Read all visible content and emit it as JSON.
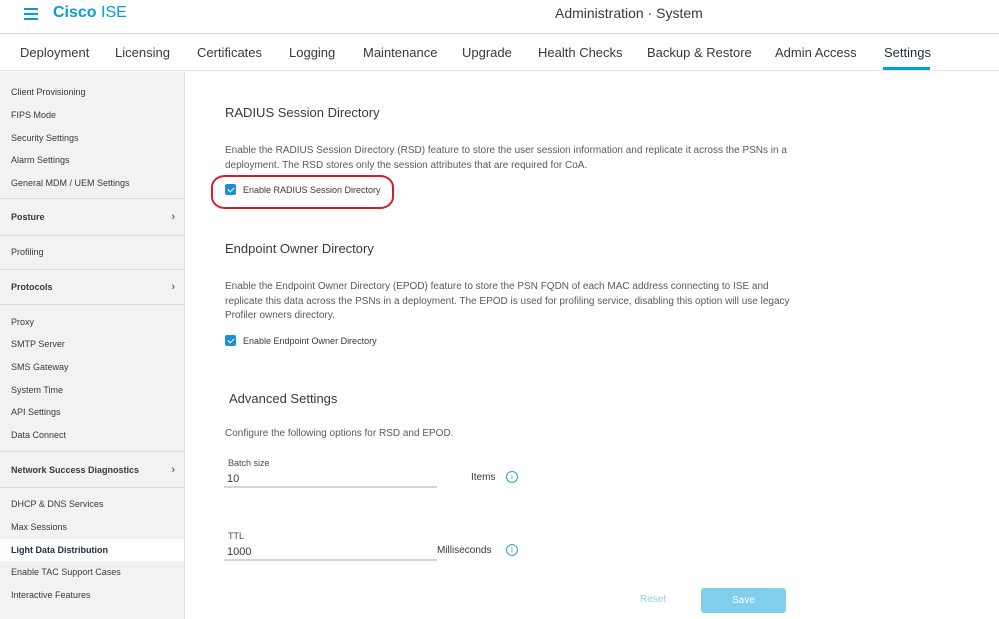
{
  "header": {
    "brand_bold": "Cisco",
    "brand_light": "ISE",
    "title": "Administration · System",
    "accent_color": "#049fd9"
  },
  "tabs": [
    {
      "label": "Deployment"
    },
    {
      "label": "Licensing"
    },
    {
      "label": "Certificates"
    },
    {
      "label": "Logging"
    },
    {
      "label": "Maintenance"
    },
    {
      "label": "Upgrade"
    },
    {
      "label": "Health Checks"
    },
    {
      "label": "Backup & Restore"
    },
    {
      "label": "Admin Access"
    },
    {
      "label": "Settings",
      "active": true
    }
  ],
  "sidebar": {
    "items": [
      {
        "label": "Client Provisioning"
      },
      {
        "label": "FIPS Mode"
      },
      {
        "label": "Security Settings"
      },
      {
        "label": "Alarm Settings"
      },
      {
        "label": "General MDM / UEM Settings"
      },
      {
        "label": "Posture",
        "group": true
      },
      {
        "label": "Profiling"
      },
      {
        "label": "Protocols",
        "group": true
      },
      {
        "label": "Proxy"
      },
      {
        "label": "SMTP Server"
      },
      {
        "label": "SMS Gateway"
      },
      {
        "label": "System Time"
      },
      {
        "label": "API Settings"
      },
      {
        "label": "Data Connect"
      },
      {
        "label": "Network Success Diagnostics",
        "group": true
      },
      {
        "label": "DHCP & DNS Services"
      },
      {
        "label": "Max Sessions"
      },
      {
        "label": "Light Data Distribution",
        "active": true
      },
      {
        "label": "Enable TAC Support Cases"
      },
      {
        "label": "Interactive Features"
      }
    ]
  },
  "rsd": {
    "title": "RADIUS Session Directory",
    "description": "Enable the RADIUS Session Directory (RSD) feature to store the user session information and replicate it across the PSNs in a deployment. The RSD stores only the session attributes that are required for CoA.",
    "checkbox_label": "Enable RADIUS Session Directory",
    "checked": true
  },
  "epod": {
    "title": "Endpoint Owner Directory",
    "description": "Enable the Endpoint Owner Directory (EPOD) feature to store the PSN FQDN of each MAC address connecting to ISE and replicate this data across the PSNs in a deployment. The EPOD is used for profiling service, disabling this option will use legacy Profiler owners directory.",
    "checkbox_label": "Enable Endpoint Owner Directory",
    "checked": true
  },
  "advanced": {
    "title": "Advanced Settings",
    "description": "Configure the following options for RSD and EPOD.",
    "batch_size": {
      "label": "Batch size",
      "value": "10",
      "unit": "Items"
    },
    "ttl": {
      "label": "TTL",
      "value": "1000",
      "unit": "Milliseconds"
    },
    "info_glyph": "i"
  },
  "actions": {
    "reset_label": "Reset",
    "save_label": "Save"
  }
}
